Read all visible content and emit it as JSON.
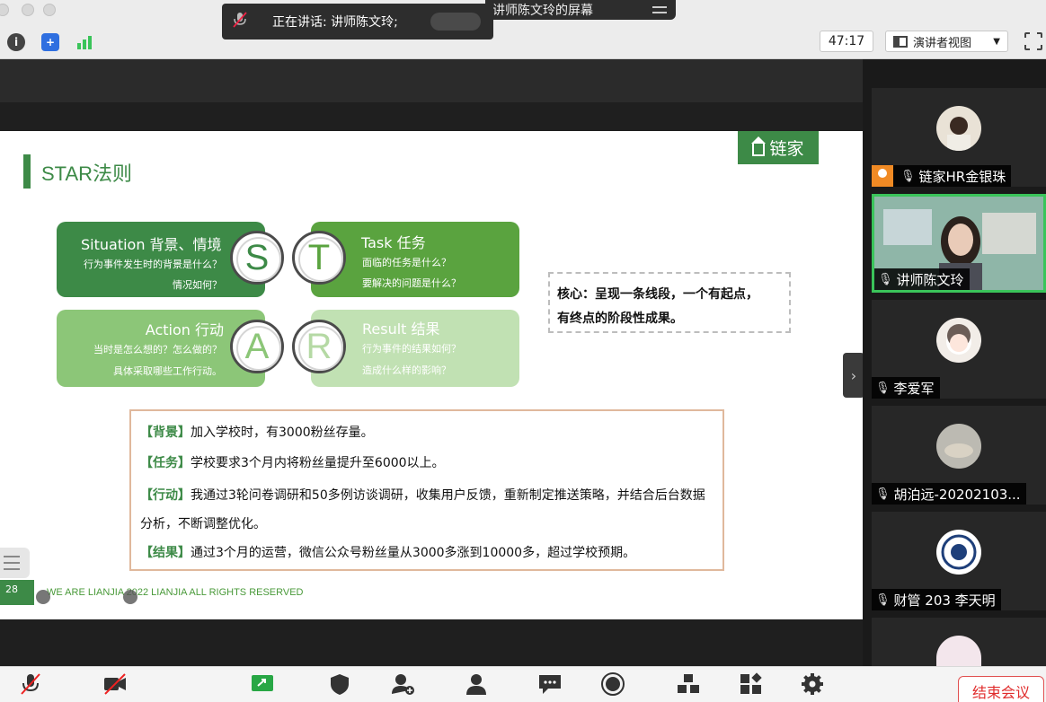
{
  "window": {
    "speaking_label": "正在讲话: 讲师陈文玲;",
    "share_title": "讲师陈文玲的屏幕",
    "timer": "47:17",
    "view_button": "演讲者视图"
  },
  "slide": {
    "title": "STAR法则",
    "logo": "链家",
    "cards": {
      "s": {
        "head": "Situation  背景、情境",
        "l1": "行为事件发生时的背景是什么？",
        "l2": "情况如何？",
        "letter": "S"
      },
      "t": {
        "head": "Task  任务",
        "l1": "面临的任务是什么？",
        "l2": "要解决的问题是什么？",
        "letter": "T"
      },
      "a": {
        "head": "Action   行动",
        "l1": "当时是怎么想的？怎么做的？",
        "l2": "具体采取哪些工作行动。",
        "letter": "A"
      },
      "r": {
        "head": "Result  结果",
        "l1": "行为事件的结果如何？",
        "l2": "造成什么样的影响？",
        "letter": "R"
      }
    },
    "core": {
      "line1": "核心：呈现一条线段，一个有起点，",
      "line2": "有终点的阶段性成果。"
    },
    "star_rows": [
      {
        "tag": "【背景】",
        "text": "加入学校时，有3000粉丝存量。"
      },
      {
        "tag": "【任务】",
        "text": "学校要求3个月内将粉丝量提升至6000以上。"
      },
      {
        "tag": "【行动】",
        "text": "我通过3轮问卷调研和50多例访谈调研，收集用户反馈，重新制定推送策略，并结合后台数据分析，不断调整优化。"
      },
      {
        "tag": "【结果】",
        "text": "通过3个月的运营，微信公众号粉丝量从3000多涨到10000多，超过学校预期。"
      }
    ],
    "footer": "WE ARE LIANJIA 2022 LIANJIA ALL RIGHTS RESERVED",
    "page_number": "28"
  },
  "participants": [
    {
      "name": "链家HR金银珠",
      "badge": true,
      "active": false
    },
    {
      "name": "讲师陈文玲",
      "badge": false,
      "active": true
    },
    {
      "name": "李爱军",
      "badge": false,
      "active": false
    },
    {
      "name": "胡泊远-20202103...",
      "badge": false,
      "active": false
    },
    {
      "name": "财管 203 李天明",
      "badge": false,
      "active": false
    }
  ],
  "controls": {
    "end_meeting": "结束会议"
  },
  "colors": {
    "brand_green": "#3d8a47",
    "active_border": "#3ac45a",
    "end_red": "#e02c2c"
  }
}
